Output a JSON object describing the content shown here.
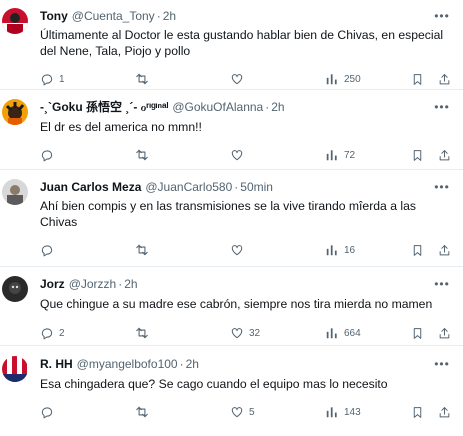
{
  "tweets": [
    {
      "name": "Tony",
      "handle": "@Cuenta_Tony",
      "dot": "·",
      "time": "2h",
      "text": "Últimamente al Doctor le esta gustando hablar bien de Chivas, en especial del Nene, Tala, Piojo y pollo",
      "replies": "1",
      "retweets": "",
      "likes": "",
      "views": "250"
    },
    {
      "name": "-¸`Goku 孫悟空 ¸´- ℴʳᶦᵍᶦⁿᵃˡ",
      "handle": "@GokuOfAlanna",
      "dot": "·",
      "time": "2h",
      "text": "El dr es del america no mmn!!",
      "replies": "",
      "retweets": "",
      "likes": "",
      "views": "72"
    },
    {
      "name": "Juan Carlos Meza",
      "handle": "@JuanCarlo580",
      "dot": "·",
      "time": "50min",
      "text": "Ahí bien compis y en las transmisiones se la vive tirando mîerda a las Chivas",
      "replies": "",
      "retweets": "",
      "likes": "",
      "views": "16"
    },
    {
      "name": "Jorz",
      "handle": "@Jorzzh",
      "dot": "·",
      "time": "2h",
      "text": "Que chingue a su madre ese cabrón, siempre nos tira mierda no mamen",
      "replies": "2",
      "retweets": "",
      "likes": "32",
      "views": "664"
    },
    {
      "name": "R. HH",
      "handle": "@myangelbofo100",
      "dot": "·",
      "time": "2h",
      "text": "Esa chingadera que? Se cago cuando el equipo mas lo necesito",
      "replies": "",
      "retweets": "",
      "likes": "5",
      "views": "143"
    }
  ],
  "icons": {
    "more": "more-icon",
    "reply": "reply-icon",
    "retweet": "retweet-icon",
    "like": "heart-icon",
    "views": "views-icon",
    "bookmark": "bookmark-icon",
    "share": "share-icon"
  },
  "colors": {
    "text": "#0f1419",
    "secondary": "#536471",
    "divider": "#e6ecf0"
  }
}
